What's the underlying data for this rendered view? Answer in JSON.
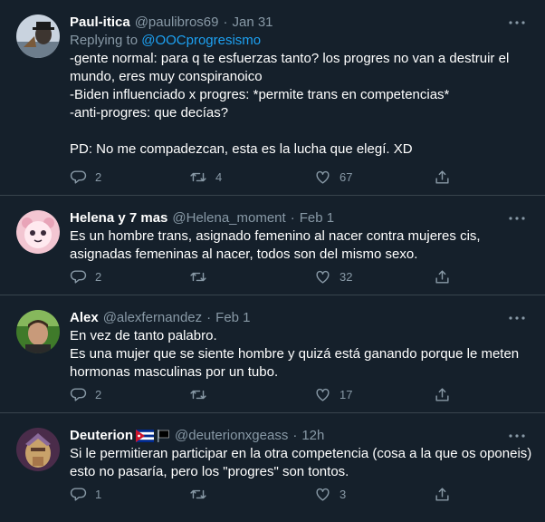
{
  "tweets": [
    {
      "name": "Paul-itica",
      "handle": "@paulibros69",
      "date": "Jan 31",
      "replying_prefix": "Replying to ",
      "replying_to": "@OOCprogresismo",
      "text": "-gente normal: para q te esfuerzas tanto? los progres no van a destruir el mundo, eres muy conspiranoico\n-Biden influenciado x progres: *permite trans en competencias*\n-anti-progres: que decías?\n\nPD: No me compadezcan, esta es la lucha que elegí. XD",
      "replies": "2",
      "retweets": "4",
      "likes": "67"
    },
    {
      "name": "Helena y 7 mas",
      "handle": "@Helena_moment",
      "date": "Feb 1",
      "text": "Es un hombre trans, asignado femenino al nacer contra mujeres cis, asignadas femeninas al nacer, todos son del mismo sexo.",
      "replies": "2",
      "retweets": "",
      "likes": "32"
    },
    {
      "name": "Alex",
      "handle": "@alexfernandez",
      "date": "Feb 1",
      "text": "En vez de tanto palabro.\nEs una mujer que se siente hombre y quizá está ganando porque le meten hormonas masculinas por un tubo.",
      "replies": "2",
      "retweets": "",
      "likes": "17"
    },
    {
      "name": "Deuterion",
      "handle": "@deuterionxgeass",
      "date": "12h",
      "text": "Si le permitieran participar en la otra competencia (cosa a la que os oponeis) esto no pasaría, pero los \"progres\" son tontos.",
      "replies": "1",
      "retweets": "",
      "likes": "3"
    }
  ],
  "dot": "·",
  "icons": [
    "more-icon",
    "reply-icon",
    "retweet-icon",
    "like-icon",
    "share-icon",
    "cuba-flag-icon",
    "black-flag-icon"
  ],
  "colors": {
    "background": "#15202b",
    "muted": "#8899a6",
    "link": "#1da1f2",
    "divider": "#38444d"
  }
}
